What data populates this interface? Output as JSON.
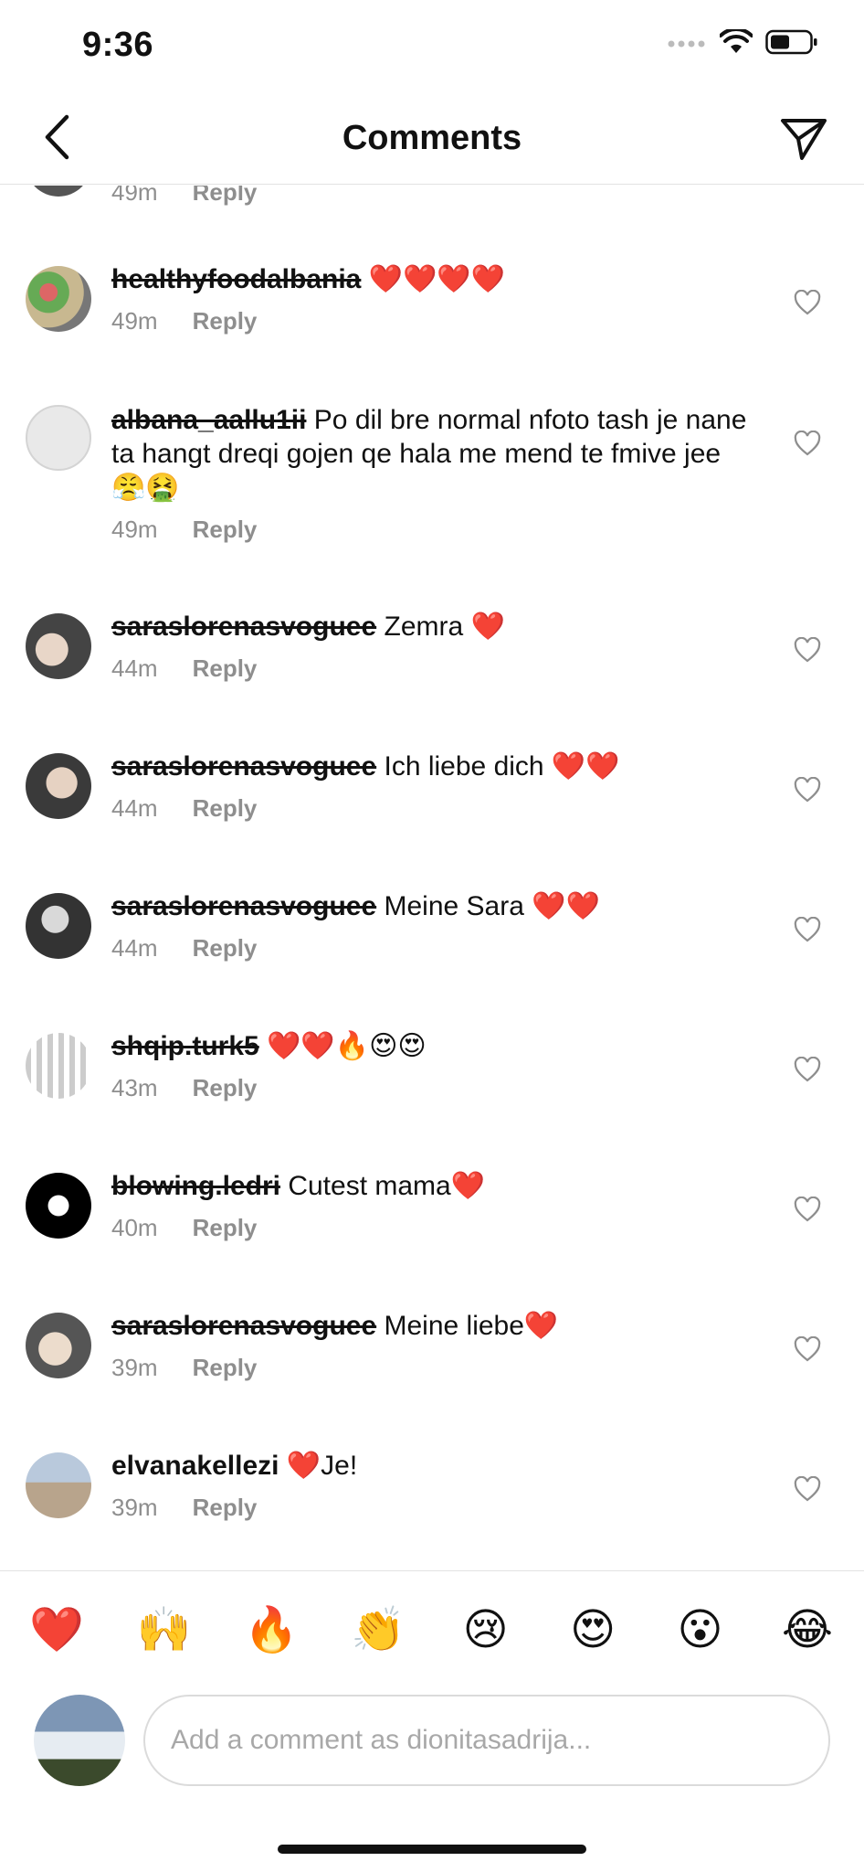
{
  "status_bar": {
    "time": "9:36"
  },
  "header": {
    "title": "Comments"
  },
  "partial_row": {
    "time": "49m",
    "reply_label": "Reply"
  },
  "comments": [
    {
      "username": "healthyfoodalbania",
      "text": " ❤️❤️❤️❤️",
      "time": "49m",
      "reply_label": "Reply"
    },
    {
      "username": "albana_aallu1ii",
      "text": " Po dil bre normal nfoto tash je nane ta hangt dreqi gojen qe hala me mend te fmive jee😤🤮",
      "time": "49m",
      "reply_label": "Reply"
    },
    {
      "username": "saraslorenasvoguee",
      "text": " Zemra ❤️",
      "time": "44m",
      "reply_label": "Reply"
    },
    {
      "username": "saraslorenasvoguee",
      "text": " Ich liebe dich ❤️❤️",
      "time": "44m",
      "reply_label": "Reply"
    },
    {
      "username": "saraslorenasvoguee",
      "text": " Meine Sara ❤️❤️",
      "time": "44m",
      "reply_label": "Reply"
    },
    {
      "username": "shqip.turk5",
      "text": " ❤️❤️🔥😍😍",
      "time": "43m",
      "reply_label": "Reply"
    },
    {
      "username": "blowing.ledri",
      "text": " Cutest mama❤️",
      "time": "40m",
      "reply_label": "Reply"
    },
    {
      "username": "saraslorenasvoguee",
      "text": " Meine liebe❤️",
      "time": "39m",
      "reply_label": "Reply"
    },
    {
      "username": "elvanakellezi",
      "text": " ❤️Je!",
      "time": "39m",
      "reply_label": "Reply"
    }
  ],
  "emoji_bar": [
    "❤️",
    "🙌",
    "🔥",
    "👏",
    "😢",
    "😍",
    "😮",
    "😂"
  ],
  "composer": {
    "placeholder": "Add a comment as dionitasadrija..."
  },
  "colors": {
    "meta_gray": "#8e8e8e",
    "heart_red": "#e0162b",
    "divider": "#e2e2e2"
  }
}
